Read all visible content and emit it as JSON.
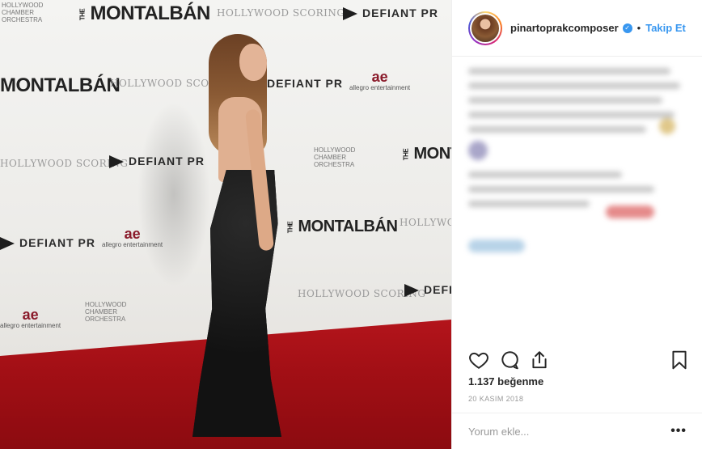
{
  "post": {
    "username": "pinartoprakcomposer",
    "verified": true,
    "follow_label": "Takip Et",
    "separator": "•",
    "likes_text": "1.137 beğenme",
    "date_text": "20 KASIM 2018",
    "comment_placeholder": "Yorum ekle...",
    "more_label": "•••"
  },
  "photo": {
    "backdrop_logos": {
      "montalban": "MONTALBÁN",
      "montalban_the": "THE",
      "hollywood": "HOLLYWOOD SCORING",
      "defiant": "DEFIANT PR",
      "allegro_mark": "ae",
      "allegro": "allegro entertainment",
      "chamber": [
        "HOLLYWOOD",
        "CHAMBER",
        "ORCHESTRA"
      ]
    }
  },
  "icons": {
    "like": "heart-icon",
    "comment": "comment-icon",
    "share": "share-icon",
    "save": "bookmark-icon",
    "verified": "verified-badge-icon"
  },
  "colors": {
    "accent": "#3897f0",
    "text": "#262626",
    "muted": "#999999",
    "carpet": "#a20f15"
  }
}
